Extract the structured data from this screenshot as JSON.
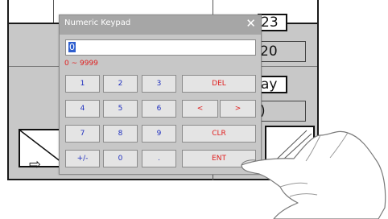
{
  "background_screen": {
    "top_value": "23",
    "value_2": "20",
    "label_partial": "ay",
    "value_3": ")",
    "arrow_left": "⇦",
    "arrow_right": "⇨"
  },
  "keypad": {
    "title": "Numeric Keypad",
    "close_glyph": "✕",
    "input_value": "0",
    "range_text": "0 ~ 9999",
    "keys": {
      "k1": "1",
      "k2": "2",
      "k3": "3",
      "del": "DEL",
      "k4": "4",
      "k5": "5",
      "k6": "6",
      "left": "<",
      "right": ">",
      "k7": "7",
      "k8": "8",
      "k9": "9",
      "clr": "CLR",
      "sign": "+/-",
      "k0": "0",
      "dot": ".",
      "ent": "ENT"
    },
    "colors": {
      "digit_text": "#1f2fbf",
      "action_text": "#e02020",
      "title_bar": "#a6a6a6",
      "selection": "#2f5fcf"
    }
  }
}
